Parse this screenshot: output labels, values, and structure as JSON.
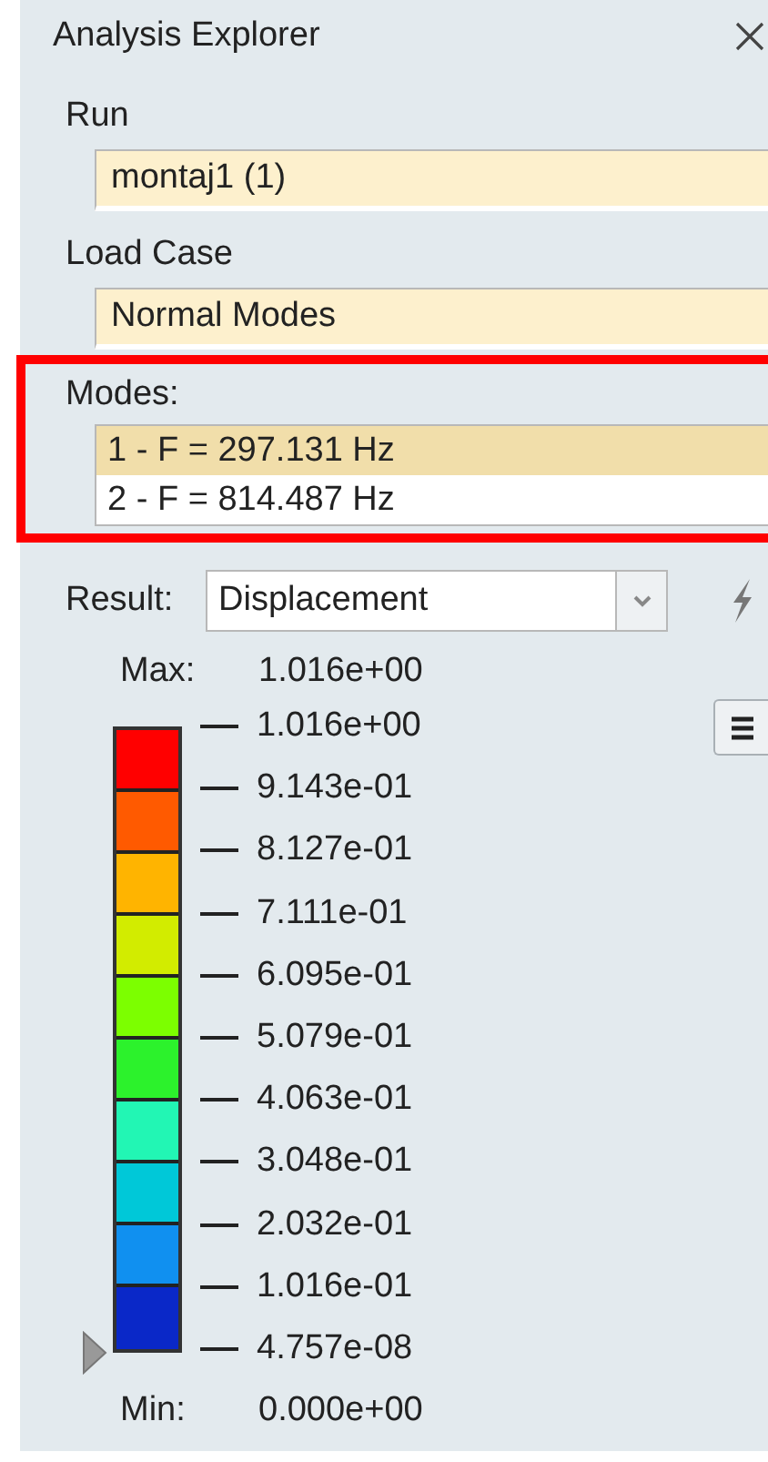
{
  "panel": {
    "title": "Analysis Explorer"
  },
  "run": {
    "label": "Run",
    "value": "montaj1 (1)"
  },
  "load_case": {
    "label": "Load Case",
    "value": "Normal Modes"
  },
  "modes": {
    "label": "Modes:",
    "items": [
      {
        "text": "1 - F = 297.131 Hz",
        "selected": true
      },
      {
        "text": "2 - F = 814.487 Hz",
        "selected": false
      }
    ]
  },
  "result": {
    "label": "Result:",
    "value": "Displacement"
  },
  "legend": {
    "max_label": "Max:",
    "max_value": "1.016e+00",
    "min_label": "Min:",
    "min_value": "0.000e+00",
    "bands": [
      {
        "color": "#ff0000"
      },
      {
        "color": "#ff5a00"
      },
      {
        "color": "#ffb400"
      },
      {
        "color": "#d2ec00"
      },
      {
        "color": "#7cff00"
      },
      {
        "color": "#2cf22c"
      },
      {
        "color": "#22f6b4"
      },
      {
        "color": "#00c8d8"
      },
      {
        "color": "#1090f0"
      },
      {
        "color": "#0a28c8"
      }
    ],
    "ticks": [
      "1.016e+00",
      "9.143e-01",
      "8.127e-01",
      "7.111e-01",
      "6.095e-01",
      "5.079e-01",
      "4.063e-01",
      "3.048e-01",
      "2.032e-01",
      "1.016e-01",
      "4.757e-08"
    ]
  }
}
